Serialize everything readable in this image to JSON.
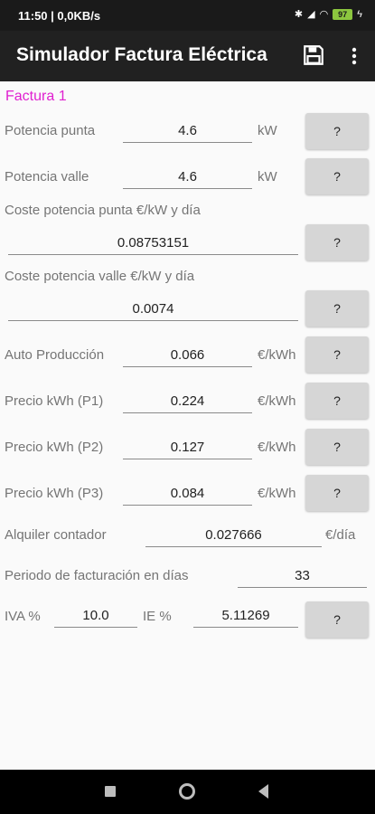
{
  "status": {
    "time": "11:50",
    "data_rate": "0,0KB/s",
    "battery": "97"
  },
  "app": {
    "title": "Simulador Factura Eléctrica",
    "section_title": "Factura 1"
  },
  "help_label": "?",
  "rows": {
    "potencia_punta": {
      "label": "Potencia punta",
      "value": "4.6",
      "unit": "kW"
    },
    "potencia_valle": {
      "label": "Potencia valle",
      "value": "4.6",
      "unit": "kW"
    },
    "coste_punta": {
      "label": "Coste potencia punta €/kW y día",
      "value": "0.08753151"
    },
    "coste_valle": {
      "label": "Coste potencia valle €/kW y día",
      "value": "0.0074"
    },
    "auto_produccion": {
      "label": "Auto Producción",
      "value": "0.066",
      "unit": "€/kWh"
    },
    "precio_p1": {
      "label": "Precio kWh (P1)",
      "value": "0.224",
      "unit": "€/kWh"
    },
    "precio_p2": {
      "label": "Precio kWh (P2)",
      "value": "0.127",
      "unit": "€/kWh"
    },
    "precio_p3": {
      "label": "Precio kWh (P3)",
      "value": "0.084",
      "unit": "€/kWh"
    },
    "alquiler": {
      "label": "Alquiler contador",
      "value": "0.027666",
      "unit": "€/día"
    },
    "periodo": {
      "label": "Periodo de facturación en días",
      "value": "33"
    },
    "iva": {
      "label": "IVA %",
      "value": "10.0"
    },
    "ie": {
      "label": "IE %",
      "value": "5.11269"
    }
  }
}
